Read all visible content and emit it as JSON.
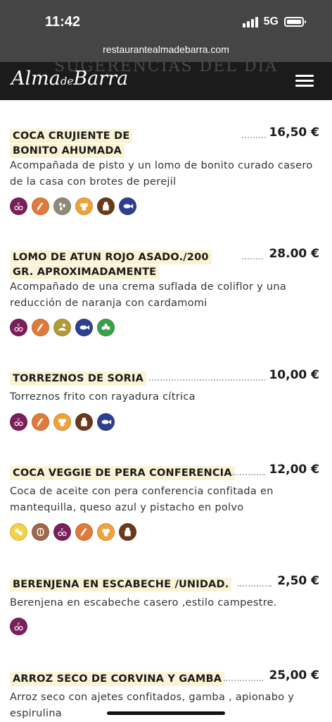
{
  "status": {
    "time": "11:42",
    "network": "5G"
  },
  "browser": {
    "url": "restaurantealmadebarra.com"
  },
  "header": {
    "logo_main": "Alma",
    "logo_small": "de",
    "logo_end": "Barra",
    "ghost_title": "SUGERENCIAS DEL DIA"
  },
  "colors": {
    "header_bg": "#1b1b1b",
    "status_bg": "#454545",
    "highlight": "#fbf3d5"
  },
  "dishes": [
    {
      "title": "COCA CRUJIENTE DE BONITO AHUMADA",
      "price": "16,50 €",
      "description": "Acompañada de pisto y un lomo de bonito curado casero de la casa con brotes de perejil",
      "allergens": [
        "sulphites-icon",
        "gluten-icon",
        "sesame-icon",
        "egg-icon",
        "milk-icon",
        "fish-icon"
      ]
    },
    {
      "title": "LOMO DE ATUN ROJO ASADO./200 GR. APROXIMADAMENTE",
      "price": "28.00 €",
      "description": "Acompañado de una crema suflada de coliflor y una reducción de naranja con cardamomi",
      "allergens": [
        "sulphites-icon",
        "gluten-icon",
        "mustard-icon",
        "fish-icon",
        "vegan-icon"
      ]
    },
    {
      "title": "TORREZNOS DE SORIA",
      "price": "10,00 €",
      "description": "Torreznos frito con rayadura cítrica",
      "allergens": [
        "sulphites-icon",
        "gluten-icon",
        "egg-icon",
        "milk-icon",
        "fish-icon"
      ]
    },
    {
      "title": "COCA VEGGIE DE PERA CONFERENCIA",
      "price": "12,00 €",
      "description": "Coca de aceite con pera conferencia confitada en mantequilla, queso azul y pistacho en polvo",
      "allergens": [
        "soy-icon",
        "nuts-icon",
        "sulphites-icon",
        "gluten-icon",
        "egg-icon",
        "milk-icon"
      ]
    },
    {
      "title": "BERENJENA EN ESCABECHE /UNIDAD.",
      "price": "2,50 €",
      "description": "Berenjena en escabeche casero ,estilo campestre.",
      "allergens": [
        "sulphites-icon"
      ]
    },
    {
      "title": "ARROZ SECO DE CORVINA Y GAMBA",
      "price": "25,00 €",
      "description": "Arroz seco con ajetes confitados, gamba , apionabo y espirulina",
      "allergens": []
    }
  ],
  "allergen_colors": {
    "sulphites-icon": "#7a1f5c",
    "gluten-icon": "#e07a3a",
    "sesame-icon": "#8f8a78",
    "egg-icon": "#f0a23a",
    "milk-icon": "#6a3a1a",
    "fish-icon": "#2f3f8f",
    "mustard-icon": "#b39a3a",
    "vegan-icon": "#3aa04a",
    "soy-icon": "#f2d24a",
    "nuts-icon": "#a0684a"
  }
}
